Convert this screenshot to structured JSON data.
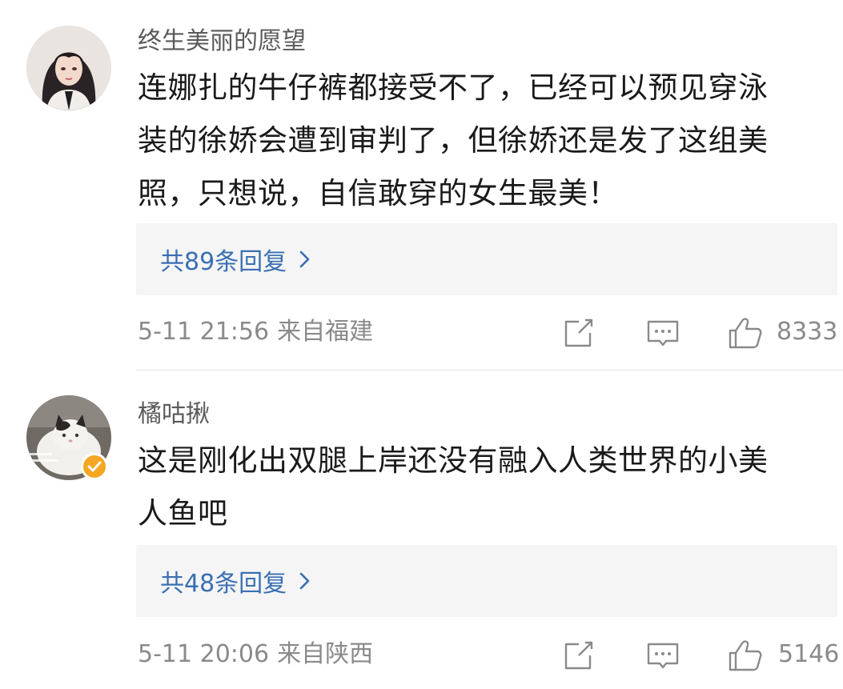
{
  "comments": [
    {
      "username": "终生美丽的愿望",
      "text_lines": [
        "连娜扎的牛仔裤都接受不了，已经可以预见穿泳",
        "装的徐娇会遭到审判了，但徐娇还是发了这组美",
        "照，只想说，自信敢穿的女生最美！"
      ],
      "replies_label": "共89条回复",
      "time": "5-11 21:56",
      "location": "来自福建",
      "likes": "8333",
      "verified": false,
      "avatar_icon": "girl-avatar"
    },
    {
      "username": "橘咕揪",
      "text_lines": [
        "这是刚化出双腿上岸还没有融入人类世界的小美",
        "人鱼吧"
      ],
      "replies_label": "共48条回复",
      "time": "5-11 20:06",
      "location": "来自陕西",
      "likes": "5146",
      "verified": true,
      "avatar_icon": "cat-avatar"
    }
  ],
  "icons": {
    "share": "share-icon",
    "comment": "comment-icon",
    "like": "like-icon",
    "chevron": "chevron-right-icon",
    "verified": "verified-badge-icon"
  },
  "colors": {
    "link_blue": "#3a6fb3",
    "meta_gray": "#8a8a8a",
    "reply_bg": "#f5f5f5",
    "verified_orange": "#f5a623"
  }
}
